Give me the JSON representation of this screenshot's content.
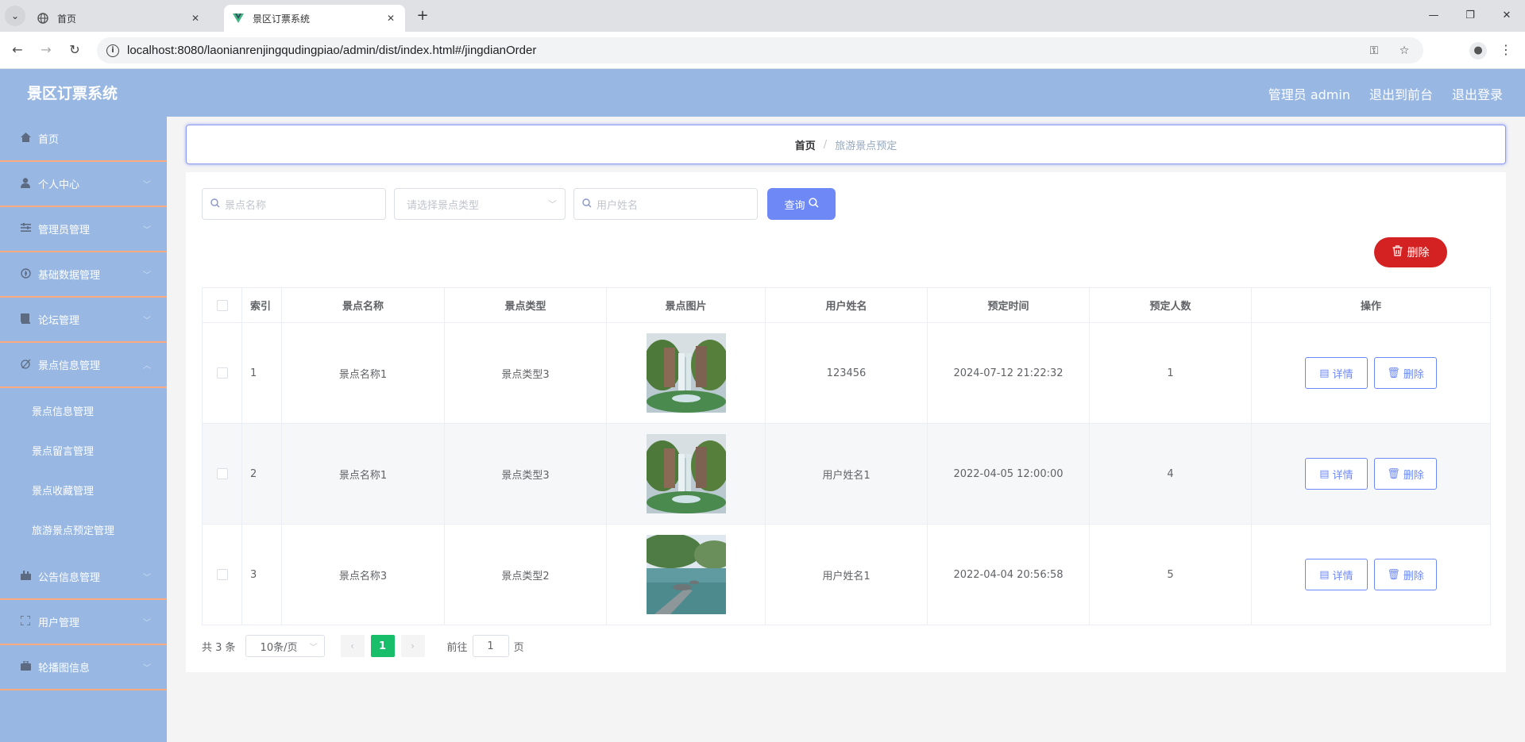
{
  "browser": {
    "tabs": [
      {
        "title": "首页",
        "favicon": "globe-icon"
      },
      {
        "title": "景区订票系统",
        "favicon": "vue-logo-icon"
      }
    ],
    "url": "localhost:8080/laonianrenjingqudingpiao/admin/dist/index.html#/jingdianOrder"
  },
  "app": {
    "title": "景区订票系统",
    "header_links": [
      "管理员 admin",
      "退出到前台",
      "退出登录"
    ]
  },
  "sidebar": {
    "items": [
      {
        "label": "首页",
        "icon": "home-icon"
      },
      {
        "label": "个人中心",
        "icon": "user-icon"
      },
      {
        "label": "管理员管理",
        "icon": "sliders-icon"
      },
      {
        "label": "基础数据管理",
        "icon": "compass-icon"
      },
      {
        "label": "论坛管理",
        "icon": "book-icon"
      },
      {
        "label": "景点信息管理",
        "icon": "scenic-icon",
        "expanded": true
      }
    ],
    "submenu": [
      "景点信息管理",
      "景点留言管理",
      "景点收藏管理",
      "旅游景点预定管理"
    ],
    "items_after": [
      {
        "label": "公告信息管理",
        "icon": "notice-icon"
      },
      {
        "label": "用户管理",
        "icon": "fullscreen-icon"
      },
      {
        "label": "轮播图信息",
        "icon": "briefcase-icon"
      }
    ]
  },
  "breadcrumb": {
    "home": "首页",
    "current": "旅游景点预定",
    "separator": "/"
  },
  "search": {
    "name_placeholder": "景点名称",
    "type_placeholder": "请选择景点类型",
    "user_placeholder": "用户姓名",
    "query_label": "查询"
  },
  "actions": {
    "delete_label": "删除"
  },
  "table": {
    "headers": [
      "索引",
      "景点名称",
      "景点类型",
      "景点图片",
      "用户姓名",
      "预定时间",
      "预定人数",
      "操作"
    ],
    "rows": [
      {
        "index": "1",
        "name": "景点名称1",
        "type": "景点类型3",
        "image": "waterfall",
        "user": "123456",
        "time": "2024-07-12 21:22:32",
        "count": "1"
      },
      {
        "index": "2",
        "name": "景点名称1",
        "type": "景点类型3",
        "image": "waterfall",
        "user": "用户姓名1",
        "time": "2022-04-05 12:00:00",
        "count": "4"
      },
      {
        "index": "3",
        "name": "景点名称3",
        "type": "景点类型2",
        "image": "lake",
        "user": "用户姓名1",
        "time": "2022-04-04 20:56:58",
        "count": "5"
      }
    ],
    "detail_label": "详情",
    "delete_label": "删除"
  },
  "pagination": {
    "total_text": "共 3 条",
    "page_size": "10条/页",
    "current_page": "1",
    "goto_prefix": "前往",
    "goto_value": "1",
    "goto_suffix": "页"
  },
  "colors": {
    "header_bg": "#98b7e2",
    "accent": "#6e89f5",
    "danger": "#d42222",
    "page_active": "#19be6b",
    "menu_divider": "#ffa97f"
  }
}
